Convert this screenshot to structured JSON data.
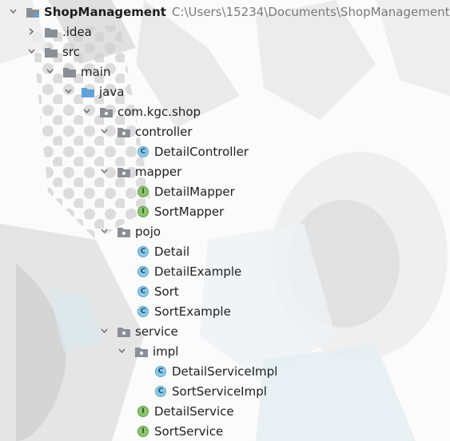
{
  "project": {
    "name": "ShopManagement",
    "path": "C:\\Users\\15234\\Documents\\ShopManagement"
  },
  "nodes": [
    {
      "label": "ShopManagement",
      "type": "project",
      "depth": 0,
      "expanded": true
    },
    {
      "label": ".idea",
      "type": "folder",
      "depth": 1,
      "expanded": false
    },
    {
      "label": "src",
      "type": "folder",
      "depth": 1,
      "expanded": true
    },
    {
      "label": "main",
      "type": "folder",
      "depth": 2,
      "expanded": true
    },
    {
      "label": "java",
      "type": "source-folder",
      "depth": 3,
      "expanded": true
    },
    {
      "label": "com.kgc.shop",
      "type": "package",
      "depth": 4,
      "expanded": true
    },
    {
      "label": "controller",
      "type": "package",
      "depth": 5,
      "expanded": true
    },
    {
      "label": "DetailController",
      "type": "class",
      "depth": 6
    },
    {
      "label": "mapper",
      "type": "package",
      "depth": 5,
      "expanded": true
    },
    {
      "label": "DetailMapper",
      "type": "interface",
      "depth": 6
    },
    {
      "label": "SortMapper",
      "type": "interface",
      "depth": 6
    },
    {
      "label": "pojo",
      "type": "package",
      "depth": 5,
      "expanded": true
    },
    {
      "label": "Detail",
      "type": "class",
      "depth": 6
    },
    {
      "label": "DetailExample",
      "type": "class",
      "depth": 6
    },
    {
      "label": "Sort",
      "type": "class",
      "depth": 6
    },
    {
      "label": "SortExample",
      "type": "class",
      "depth": 6
    },
    {
      "label": "service",
      "type": "package",
      "depth": 5,
      "expanded": true
    },
    {
      "label": "impl",
      "type": "package",
      "depth": 6,
      "expanded": true
    },
    {
      "label": "DetailServiceImpl",
      "type": "class",
      "depth": 7
    },
    {
      "label": "SortServiceImpl",
      "type": "class",
      "depth": 7
    },
    {
      "label": "DetailService",
      "type": "interface",
      "depth": 6
    },
    {
      "label": "SortService",
      "type": "interface",
      "depth": 6
    }
  ],
  "icons": {
    "class_letter": "C",
    "interface_letter": "I"
  },
  "colors": {
    "folder": "#8a8f96",
    "source_folder": "#5fa3d8",
    "class_badge": "#8dc9e6",
    "interface_badge": "#8cc46f",
    "text": "#1e1e1e",
    "path_text": "#7a7a7a"
  }
}
